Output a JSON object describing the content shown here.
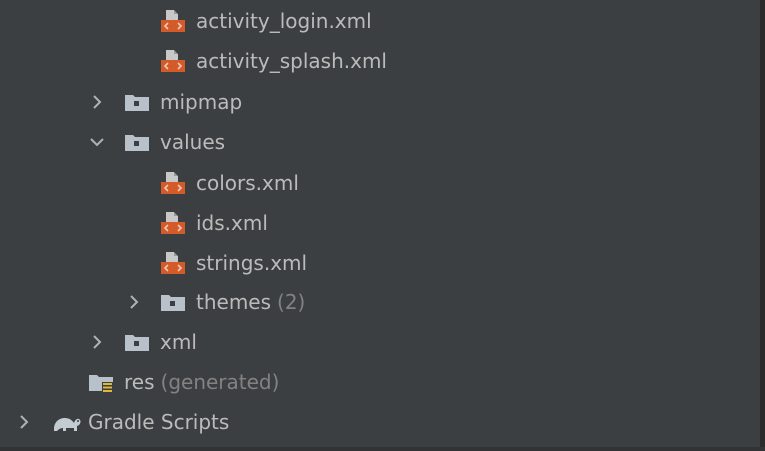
{
  "tree": {
    "items": [
      {
        "label": "activity_login.xml",
        "icon": "xml-file-icon"
      },
      {
        "label": "activity_splash.xml",
        "icon": "xml-file-icon"
      },
      {
        "label": "mipmap",
        "icon": "folder-icon",
        "arrow": "chevron-right-icon"
      },
      {
        "label": "values",
        "icon": "folder-icon",
        "arrow": "chevron-down-icon"
      },
      {
        "label": "colors.xml",
        "icon": "xml-file-icon"
      },
      {
        "label": "ids.xml",
        "icon": "xml-file-icon"
      },
      {
        "label": "strings.xml",
        "icon": "xml-file-icon"
      },
      {
        "label": "themes",
        "suffix": "(2)",
        "icon": "folder-icon",
        "arrow": "chevron-right-icon"
      },
      {
        "label": "xml",
        "icon": "folder-icon",
        "arrow": "chevron-right-icon"
      },
      {
        "label": "res",
        "suffix": "(generated)",
        "icon": "resource-folder-icon"
      },
      {
        "label": "Gradle Scripts",
        "icon": "gradle-elephant-icon",
        "arrow": "chevron-right-icon"
      }
    ]
  },
  "colors": {
    "background": "#3c3f41",
    "text": "#bbbbbb",
    "muted": "#828282",
    "xml_icon_orange": "#d35b2a",
    "folder_gray": "#a9b7c6"
  }
}
